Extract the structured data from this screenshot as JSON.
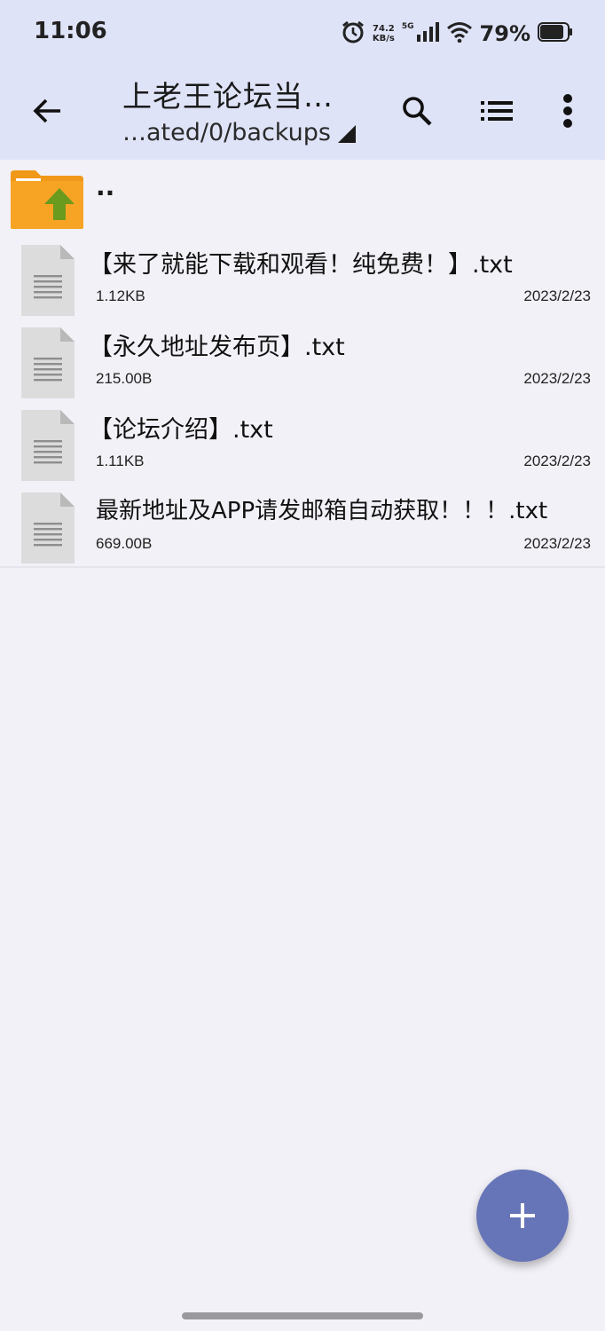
{
  "status_bar": {
    "time": "11:06",
    "net_speed_value": "74.2",
    "net_speed_unit": "KB/s",
    "network_type": "5G",
    "battery_percent": "79%"
  },
  "toolbar": {
    "title": "上老王论坛当…",
    "path": "…ated/0/backups"
  },
  "files": {
    "parent_label": "..",
    "items": [
      {
        "name": "【来了就能下载和观看！纯免费！】.txt",
        "size": "1.12KB",
        "date": "2023/2/23"
      },
      {
        "name": "【永久地址发布页】.txt",
        "size": "215.00B",
        "date": "2023/2/23"
      },
      {
        "name": "【论坛介绍】.txt",
        "size": "1.11KB",
        "date": "2023/2/23"
      },
      {
        "name": "最新地址及APP请发邮箱自动获取！！！.txt",
        "size": "669.00B",
        "date": "2023/2/23"
      }
    ]
  },
  "colors": {
    "header_bg": "#dfe3f7",
    "page_bg": "#f2f1f7",
    "fab_bg": "#6674b8",
    "folder_orange": "#f7a424",
    "folder_arrow": "#6a9a1e"
  }
}
